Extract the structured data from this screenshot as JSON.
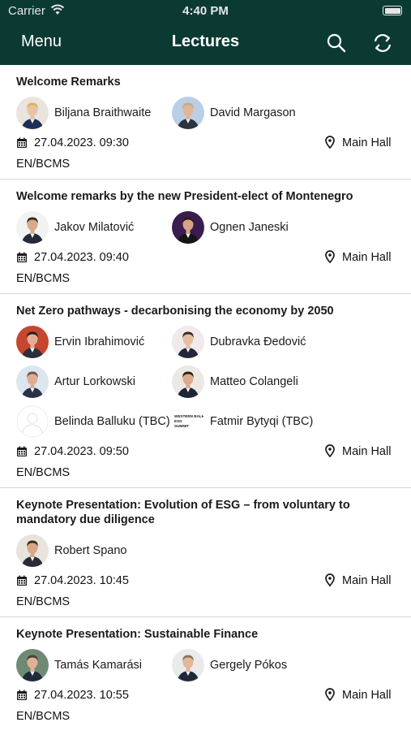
{
  "status_bar": {
    "carrier": "Carrier",
    "time": "4:40 PM"
  },
  "nav": {
    "menu_label": "Menu",
    "title": "Lectures",
    "search_icon": "search-icon",
    "refresh_icon": "refresh-icon"
  },
  "colors": {
    "header_bg": "#0b3a33",
    "header_text": "#ffffff",
    "divider": "#d6d6d6"
  },
  "lectures": [
    {
      "title": "Welcome Remarks",
      "speakers": [
        {
          "name": "Biljana Braithwaite"
        },
        {
          "name": "David Margason"
        }
      ],
      "datetime": "27.04.2023. 09:30",
      "location": "Main Hall",
      "language": "EN/BCMS"
    },
    {
      "title": "Welcome remarks by the new President-elect of Montenegro",
      "speakers": [
        {
          "name": "Jakov Milatović"
        },
        {
          "name": "Ognen  Janeski"
        }
      ],
      "datetime": "27.04.2023. 09:40",
      "location": "Main Hall",
      "language": "EN/BCMS"
    },
    {
      "title": "Net Zero pathways - decarbonising the economy by 2050",
      "speakers": [
        {
          "name": "Ervin Ibrahimović"
        },
        {
          "name": "Dubravka  Đedović"
        },
        {
          "name": "Artur Lorkowski"
        },
        {
          "name": "Matteo Colangeli"
        },
        {
          "name": "Belinda Balluku (TBC)"
        },
        {
          "name": "Fatmir Bytyqi (TBC)",
          "logo_text": "WESTERN BALKANS ESG SUMMIT"
        }
      ],
      "datetime": "27.04.2023. 09:50",
      "location": "Main Hall",
      "language": "EN/BCMS"
    },
    {
      "title": "Keynote Presentation: Evolution of ESG – from voluntary to mandatory due diligence",
      "speakers": [
        {
          "name": "Robert Spano"
        }
      ],
      "datetime": "27.04.2023. 10:45",
      "location": "Main Hall",
      "language": "EN/BCMS"
    },
    {
      "title": "Keynote Presentation: Sustainable Finance",
      "speakers": [
        {
          "name": "Tamás Kamarási"
        },
        {
          "name": "Gergely Pókos"
        }
      ],
      "datetime": "27.04.2023. 10:55",
      "location": "Main Hall",
      "language": "EN/BCMS"
    }
  ]
}
